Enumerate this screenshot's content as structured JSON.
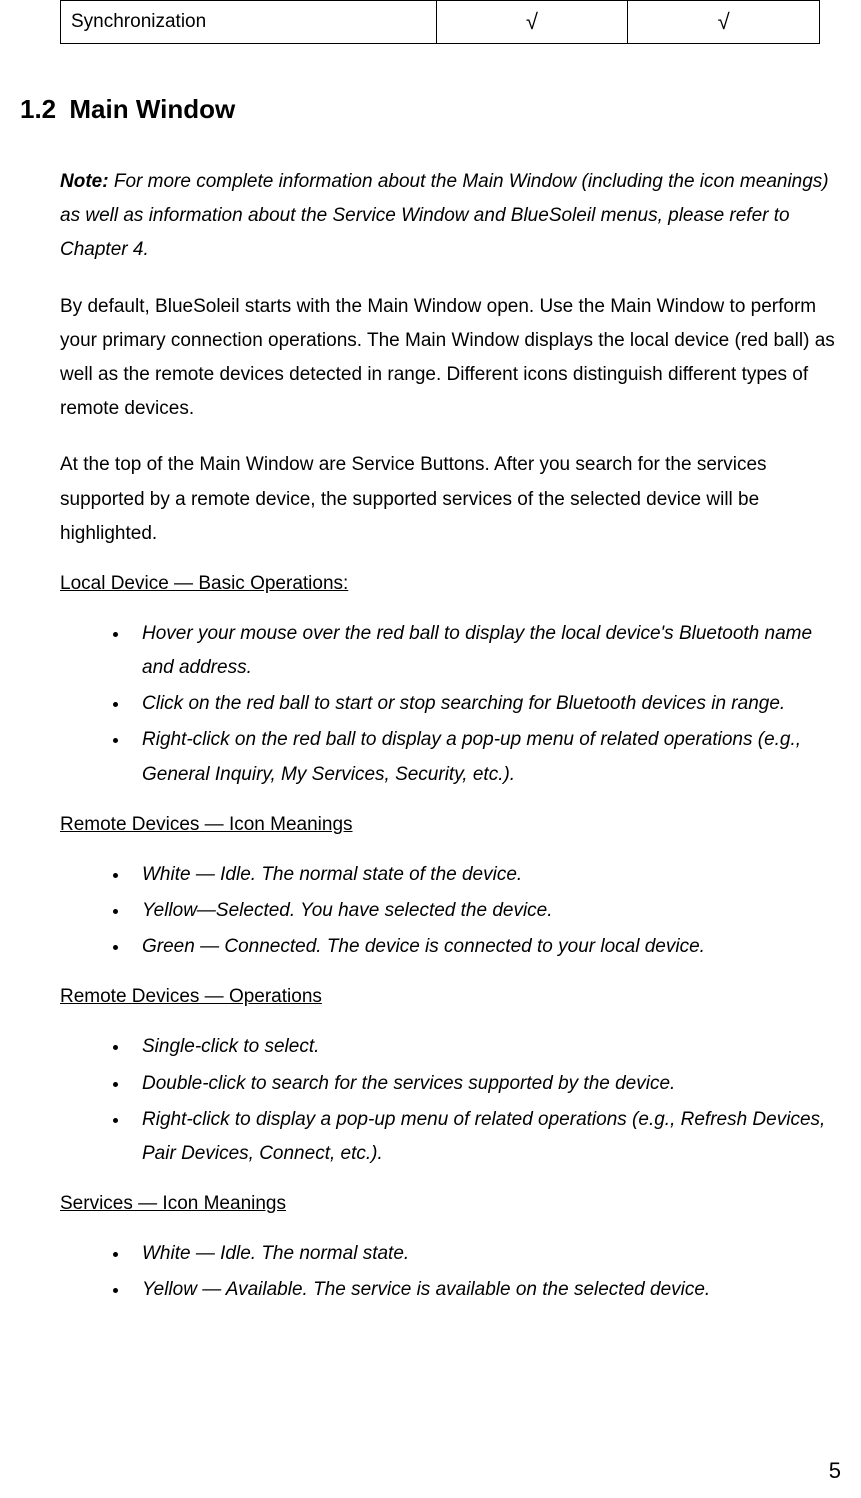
{
  "tableRow": {
    "label": "Synchronization",
    "col1": "√",
    "col2": "√"
  },
  "section": {
    "num": "1.2",
    "title": "Main Window"
  },
  "note": {
    "label": "Note:",
    "text": "For more complete information about the Main Window (including the icon meanings) as well as information about the Service Window and BlueSoleil menus, please refer to Chapter 4."
  },
  "para1": "By default, BlueSoleil starts with the Main Window open. Use the Main Window to perform your primary connection operations. The Main Window displays the local device (red ball) as well as the remote devices detected in range. Different icons distinguish different types of remote devices.",
  "para2": "At the top of the Main Window are Service Buttons. After you search for the services supported by a remote device, the supported services of the selected device will be highlighted.",
  "sub1": "Local Device — Basic Operations:",
  "list1": [
    "Hover your mouse over the red ball to display the local device's Bluetooth name and address.",
    "Click on the red ball to start or stop searching for Bluetooth devices in range.",
    "Right-click on the red ball to display a pop-up menu of related operations (e.g., General Inquiry, My Services, Security, etc.)."
  ],
  "sub2": "Remote Devices — Icon Meanings",
  "list2": [
    "White — Idle. The normal state of the device.",
    "Yellow—Selected. You have selected the device.",
    "Green — Connected. The device is connected to your local device."
  ],
  "sub3": "Remote Devices — Operations",
  "list3": [
    "Single-click to select.",
    "Double-click to search for the services supported by the device.",
    "Right-click to display a pop-up menu of related operations (e.g., Refresh Devices, Pair Devices, Connect, etc.)."
  ],
  "sub4": "Services — Icon Meanings",
  "list4": [
    "White — Idle. The normal state.",
    "Yellow — Available. The service is available on the selected device."
  ],
  "pageNum": "5"
}
